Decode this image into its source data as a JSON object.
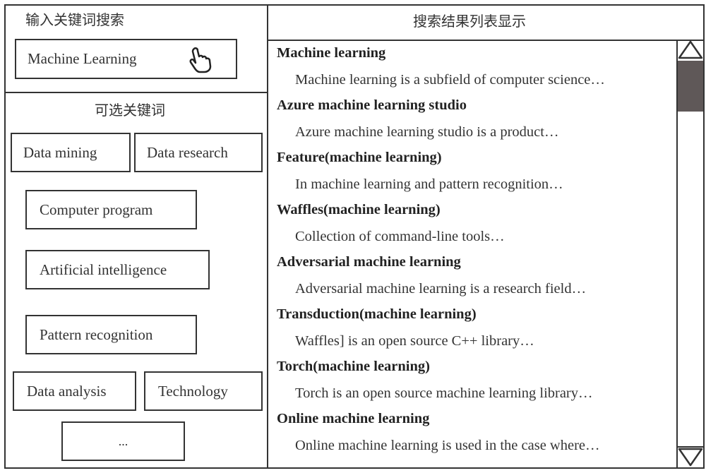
{
  "search_panel": {
    "title": "输入关键词搜索",
    "input_value": "Machine Learning",
    "cursor_icon": "hand-pointer-icon"
  },
  "keywords_panel": {
    "title": "可选关键词",
    "keywords": [
      "Data mining",
      "Data research",
      "Computer program",
      "Artificial intelligence",
      "Pattern recognition",
      "Data analysis",
      "Technology",
      "..."
    ]
  },
  "results_panel": {
    "title": "搜索结果列表显示",
    "results": [
      {
        "title": "Machine learning",
        "snippet": "Machine learning is a subfield of computer science…"
      },
      {
        "title": "Azure machine learning studio",
        "snippet": "Azure machine learning studio is a product…"
      },
      {
        "title": "Feature(machine learning)",
        "snippet": "In machine learning and pattern recognition…"
      },
      {
        "title": "Waffles(machine learning)",
        "snippet": "Collection of command-line tools…"
      },
      {
        "title": "Adversarial machine learning",
        "snippet": "Adversarial machine learning is a research field…"
      },
      {
        "title": "Transduction(machine learning)",
        "snippet": "Waffles] is an open source C++ library…"
      },
      {
        "title": "Torch(machine learning)",
        "snippet": "Torch is an open source machine learning library…"
      },
      {
        "title": "Online machine learning",
        "snippet": "Online machine learning is used in the case where…"
      }
    ],
    "scrollbar": {
      "up_icon": "triangle-up-icon",
      "down_icon": "triangle-down-icon",
      "thumb_color": "#5f5858",
      "scroll_position_fraction": 0.0
    }
  }
}
